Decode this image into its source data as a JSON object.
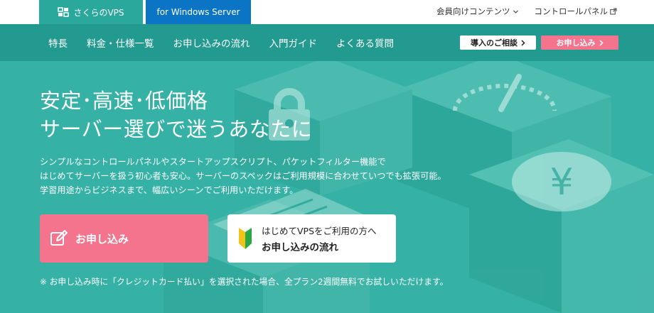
{
  "topbar": {
    "brand_label": "さくらのVPS",
    "windows_tab_label": "for Windows Server",
    "links": [
      {
        "label": "会員向けコンテンツ",
        "icon": "chevron-down-icon"
      },
      {
        "label": "コントロールパネル",
        "icon": "external-link-icon"
      }
    ]
  },
  "nav": {
    "items": [
      "特長",
      "料金・仕様一覧",
      "お申し込みの流れ",
      "入門ガイド",
      "よくある質問"
    ],
    "consult_label": "導入のご相談",
    "apply_label": "お申し込み"
  },
  "hero": {
    "title_line1": "安定･高速･低価格",
    "title_line2": "サーバー選びで迷うあなたに",
    "desc_line1": "シンプルなコントロールパネルやスタートアップスクリプト、パケットフィルター機能で",
    "desc_line2": "はじめてサーバーを扱う初心者も安心。サーバーのスペックはご利用規模に合わせていつでも拡張可能。",
    "desc_line3": "学習用途からビジネスまで、幅広いシーンでご利用いただけます。",
    "apply_button_label": "お申し込み",
    "flow_button_line1": "はじめてVPSをご利用の方へ",
    "flow_button_line2": "お申し込みの流れ",
    "note": "※ お申し込み時に「クレジットカード払い」を選択された場合、全プラン2週間無料でお試しいただけます。"
  },
  "colors": {
    "brand_teal": "#2ba89c",
    "nav_teal": "#239a8f",
    "windows_blue": "#0b74c4",
    "apply_pink": "#f4748e"
  }
}
